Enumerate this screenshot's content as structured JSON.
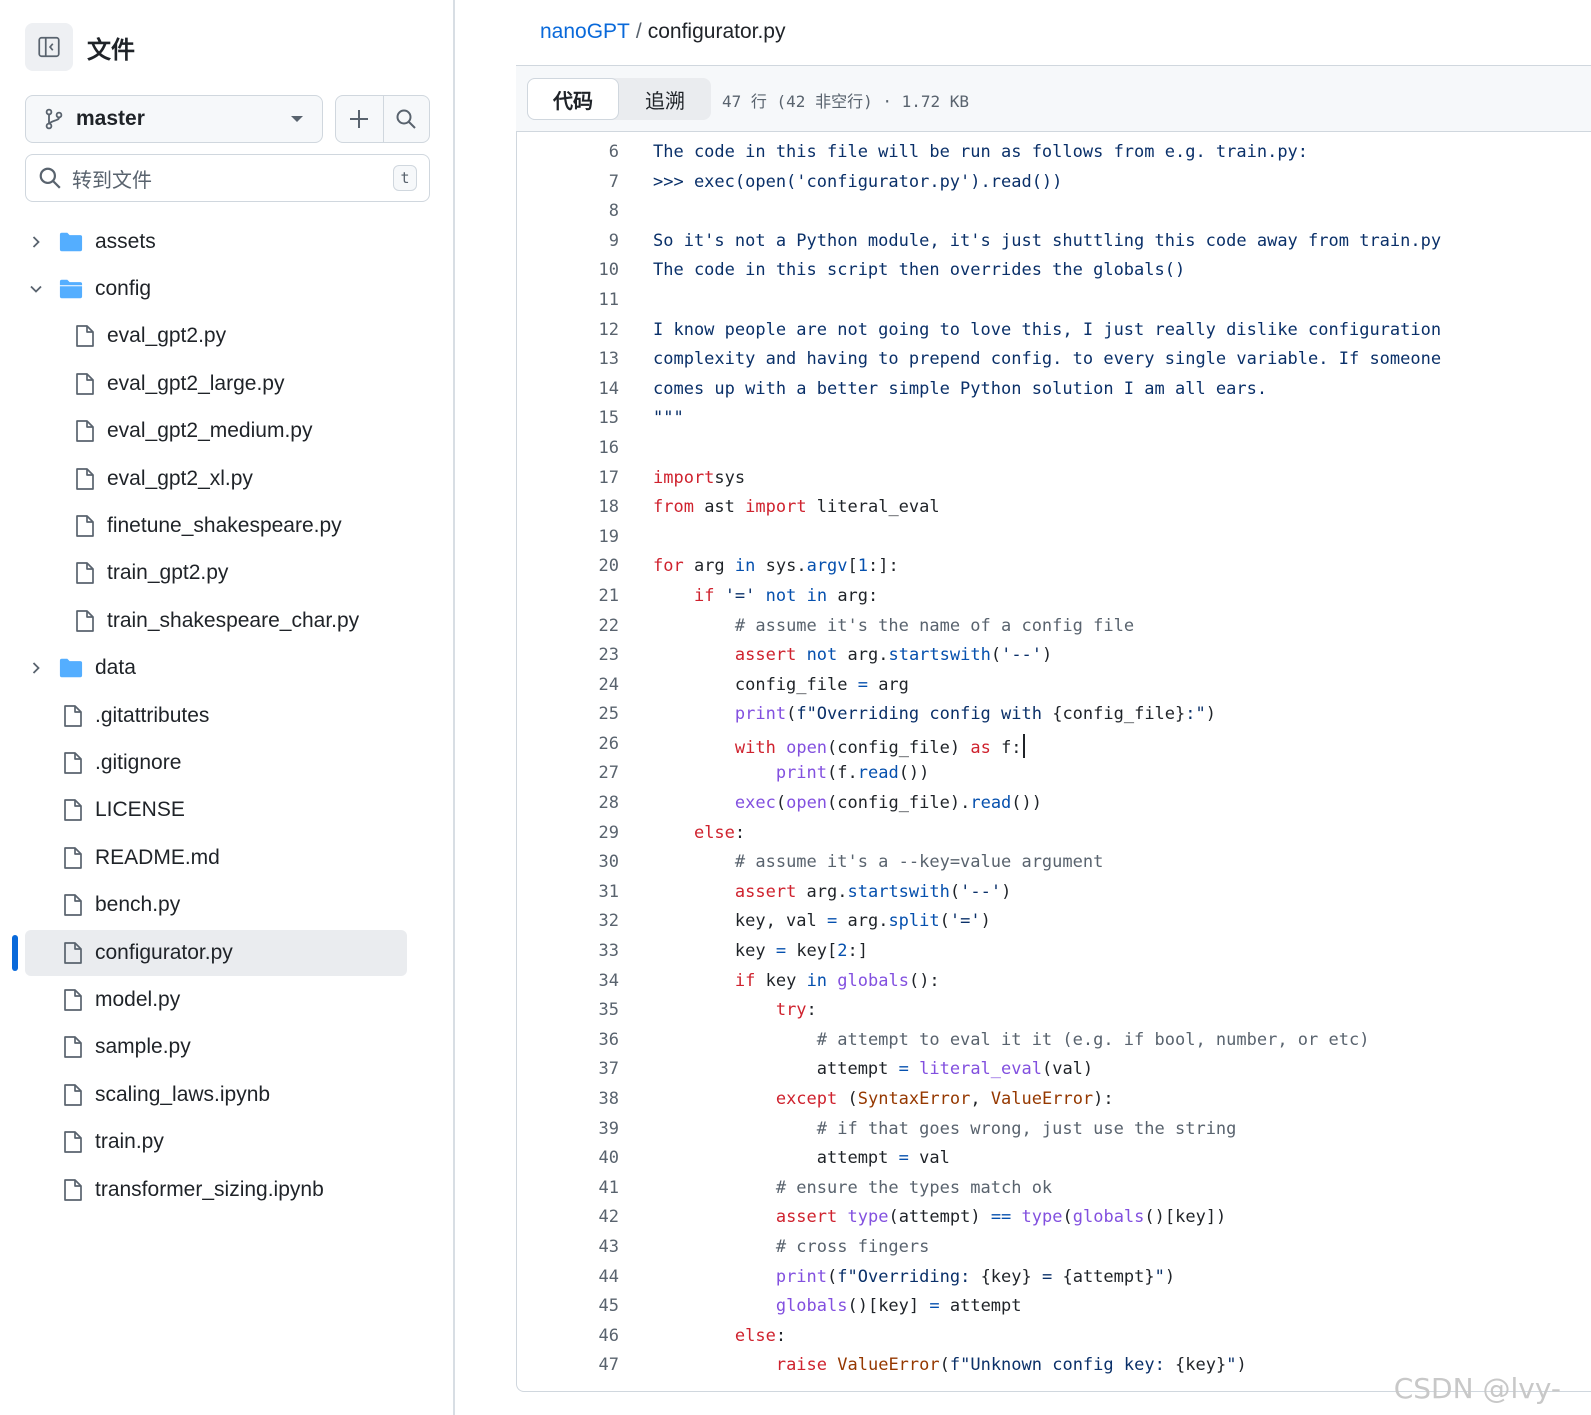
{
  "sidebar": {
    "title": "文件",
    "branch": "master",
    "goto_placeholder": "转到文件",
    "goto_shortcut": "t",
    "items": [
      {
        "name": "assets",
        "type": "folder",
        "level": 0,
        "expanded": false
      },
      {
        "name": "config",
        "type": "folder",
        "level": 0,
        "expanded": true
      },
      {
        "name": "eval_gpt2.py",
        "type": "file",
        "level": 1
      },
      {
        "name": "eval_gpt2_large.py",
        "type": "file",
        "level": 1
      },
      {
        "name": "eval_gpt2_medium.py",
        "type": "file",
        "level": 1
      },
      {
        "name": "eval_gpt2_xl.py",
        "type": "file",
        "level": 1
      },
      {
        "name": "finetune_shakespeare.py",
        "type": "file",
        "level": 1
      },
      {
        "name": "train_gpt2.py",
        "type": "file",
        "level": 1
      },
      {
        "name": "train_shakespeare_char.py",
        "type": "file",
        "level": 1
      },
      {
        "name": "data",
        "type": "folder",
        "level": 0,
        "expanded": false
      },
      {
        "name": ".gitattributes",
        "type": "file",
        "level": 0
      },
      {
        "name": ".gitignore",
        "type": "file",
        "level": 0
      },
      {
        "name": "LICENSE",
        "type": "file",
        "level": 0
      },
      {
        "name": "README.md",
        "type": "file",
        "level": 0
      },
      {
        "name": "bench.py",
        "type": "file",
        "level": 0
      },
      {
        "name": "configurator.py",
        "type": "file",
        "level": 0,
        "active": true
      },
      {
        "name": "model.py",
        "type": "file",
        "level": 0
      },
      {
        "name": "sample.py",
        "type": "file",
        "level": 0
      },
      {
        "name": "scaling_laws.ipynb",
        "type": "file",
        "level": 0
      },
      {
        "name": "train.py",
        "type": "file",
        "level": 0
      },
      {
        "name": "transformer_sizing.ipynb",
        "type": "file",
        "level": 0
      }
    ]
  },
  "breadcrumb": {
    "repo": "nanoGPT",
    "separator": "/",
    "file": "configurator.py"
  },
  "toolbar": {
    "code_tab": "代码",
    "blame_tab": "追溯",
    "meta": "47 行 (42 非空行) · 1.72 KB"
  },
  "code": {
    "first_line": 6,
    "lines": [
      [
        [
          "doc",
          "The code in this file will be run as follows from e.g. train.py:"
        ]
      ],
      [
        [
          "doc",
          ">>> exec(open('configurator.py').read())"
        ]
      ],
      [],
      [
        [
          "doc",
          "So it's not a Python module, it's just shuttling this code away from train.py"
        ]
      ],
      [
        [
          "doc",
          "The code in this script then overrides the globals()"
        ]
      ],
      [],
      [
        [
          "doc",
          "I know people are not going to love this, I just really dislike configuration"
        ]
      ],
      [
        [
          "doc",
          "complexity and having to prepend config. to every single variable. If someone"
        ]
      ],
      [
        [
          "doc",
          "comes up with a better simple Python solution I am all ears."
        ]
      ],
      [
        [
          "doc",
          "\"\"\""
        ]
      ],
      [],
      [
        [
          "k",
          "import"
        ],
        [
          "",
          "sys"
        ]
      ],
      [
        [
          "k",
          "from"
        ],
        [
          "",
          " ast "
        ],
        [
          "k",
          "import"
        ],
        [
          "",
          " literal_eval"
        ]
      ],
      [],
      [
        [
          "k",
          "for"
        ],
        [
          "",
          " arg "
        ],
        [
          "b",
          "in"
        ],
        [
          "",
          " sys."
        ],
        [
          "b",
          "argv"
        ],
        [
          "",
          "["
        ],
        [
          "b",
          "1"
        ],
        [
          "",
          ":]:"
        ]
      ],
      [
        [
          "",
          "    "
        ],
        [
          "k",
          "if"
        ],
        [
          "",
          " "
        ],
        [
          "s",
          "'='"
        ],
        [
          "",
          " "
        ],
        [
          "b",
          "not in"
        ],
        [
          "",
          " arg:"
        ]
      ],
      [
        [
          "",
          "        "
        ],
        [
          "c",
          "# assume it's the name of a config file"
        ]
      ],
      [
        [
          "",
          "        "
        ],
        [
          "k",
          "assert"
        ],
        [
          "",
          " "
        ],
        [
          "b",
          "not"
        ],
        [
          "",
          " arg."
        ],
        [
          "b",
          "startswith"
        ],
        [
          "",
          "("
        ],
        [
          "s",
          "'--'"
        ],
        [
          "",
          ")"
        ]
      ],
      [
        [
          "",
          "        config_file "
        ],
        [
          "b",
          "="
        ],
        [
          "",
          " arg"
        ]
      ],
      [
        [
          "",
          "        "
        ],
        [
          "f",
          "print"
        ],
        [
          "",
          "("
        ],
        [
          "s",
          "f\"Overriding config with "
        ],
        [
          "",
          "{config_file}"
        ],
        [
          "s",
          ":\""
        ],
        [
          "",
          ")"
        ]
      ],
      [
        [
          "",
          "        "
        ],
        [
          "k",
          "with"
        ],
        [
          "",
          " "
        ],
        [
          "f",
          "open"
        ],
        [
          "",
          "(config_file) "
        ],
        [
          "k",
          "as"
        ],
        [
          "",
          " f:"
        ],
        [
          "caret",
          ""
        ]
      ],
      [
        [
          "",
          "            "
        ],
        [
          "f",
          "print"
        ],
        [
          "",
          "(f."
        ],
        [
          "b",
          "read"
        ],
        [
          "",
          "())"
        ]
      ],
      [
        [
          "",
          "        "
        ],
        [
          "f",
          "exec"
        ],
        [
          "",
          "("
        ],
        [
          "f",
          "open"
        ],
        [
          "",
          "(config_file)."
        ],
        [
          "b",
          "read"
        ],
        [
          "",
          "())"
        ]
      ],
      [
        [
          "",
          "    "
        ],
        [
          "k",
          "else"
        ],
        [
          "",
          ":"
        ]
      ],
      [
        [
          "",
          "        "
        ],
        [
          "c",
          "# assume it's a --key=value argument"
        ]
      ],
      [
        [
          "",
          "        "
        ],
        [
          "k",
          "assert"
        ],
        [
          "",
          " arg."
        ],
        [
          "b",
          "startswith"
        ],
        [
          "",
          "("
        ],
        [
          "s",
          "'--'"
        ],
        [
          "",
          ")"
        ]
      ],
      [
        [
          "",
          "        key, val "
        ],
        [
          "b",
          "="
        ],
        [
          "",
          " arg."
        ],
        [
          "b",
          "split"
        ],
        [
          "",
          "("
        ],
        [
          "s",
          "'='"
        ],
        [
          "",
          ")"
        ]
      ],
      [
        [
          "",
          "        key "
        ],
        [
          "b",
          "="
        ],
        [
          "",
          " key["
        ],
        [
          "b",
          "2"
        ],
        [
          "",
          ":]"
        ]
      ],
      [
        [
          "",
          "        "
        ],
        [
          "k",
          "if"
        ],
        [
          "",
          " key "
        ],
        [
          "b",
          "in"
        ],
        [
          "",
          " "
        ],
        [
          "f",
          "globals"
        ],
        [
          "",
          "():"
        ]
      ],
      [
        [
          "",
          "            "
        ],
        [
          "k",
          "try"
        ],
        [
          "",
          ":"
        ]
      ],
      [
        [
          "",
          "                "
        ],
        [
          "c",
          "# attempt to eval it it (e.g. if bool, number, or etc)"
        ]
      ],
      [
        [
          "",
          "                attempt "
        ],
        [
          "b",
          "="
        ],
        [
          "",
          " "
        ],
        [
          "f",
          "literal_eval"
        ],
        [
          "",
          "(val)"
        ]
      ],
      [
        [
          "",
          "            "
        ],
        [
          "k",
          "except"
        ],
        [
          "",
          " ("
        ],
        [
          "o",
          "SyntaxError"
        ],
        [
          "",
          ", "
        ],
        [
          "o",
          "ValueError"
        ],
        [
          "",
          "):"
        ]
      ],
      [
        [
          "",
          "                "
        ],
        [
          "c",
          "# if that goes wrong, just use the string"
        ]
      ],
      [
        [
          "",
          "                attempt "
        ],
        [
          "b",
          "="
        ],
        [
          "",
          " val"
        ]
      ],
      [
        [
          "",
          "            "
        ],
        [
          "c",
          "# ensure the types match ok"
        ]
      ],
      [
        [
          "",
          "            "
        ],
        [
          "k",
          "assert"
        ],
        [
          "",
          " "
        ],
        [
          "f",
          "type"
        ],
        [
          "",
          "(attempt) "
        ],
        [
          "b",
          "=="
        ],
        [
          "",
          " "
        ],
        [
          "f",
          "type"
        ],
        [
          "",
          "("
        ],
        [
          "f",
          "globals"
        ],
        [
          "",
          "()[key])"
        ]
      ],
      [
        [
          "",
          "            "
        ],
        [
          "c",
          "# cross fingers"
        ]
      ],
      [
        [
          "",
          "            "
        ],
        [
          "f",
          "print"
        ],
        [
          "",
          "("
        ],
        [
          "s",
          "f\"Overriding: "
        ],
        [
          "",
          "{key}"
        ],
        [
          "s",
          " = "
        ],
        [
          "",
          "{attempt}"
        ],
        [
          "s",
          "\""
        ],
        [
          "",
          ")"
        ]
      ],
      [
        [
          "",
          "            "
        ],
        [
          "f",
          "globals"
        ],
        [
          "",
          "()[key] "
        ],
        [
          "b",
          "="
        ],
        [
          "",
          " attempt"
        ]
      ],
      [
        [
          "",
          "        "
        ],
        [
          "k",
          "else"
        ],
        [
          "",
          ":"
        ]
      ],
      [
        [
          "",
          "            "
        ],
        [
          "k",
          "raise"
        ],
        [
          "",
          " "
        ],
        [
          "o",
          "ValueError"
        ],
        [
          "",
          "("
        ],
        [
          "s",
          "f\"Unknown config key: "
        ],
        [
          "",
          "{key}"
        ],
        [
          "s",
          "\""
        ],
        [
          "",
          ")"
        ]
      ]
    ]
  },
  "watermark": "CSDN @lvy-",
  "colors": {
    "accent": "#0969da",
    "keyword": "#cf222e",
    "builtin": "#0550ae",
    "function": "#8250df",
    "string": "#0a3069",
    "comment": "#59636e",
    "exception": "#953800"
  }
}
